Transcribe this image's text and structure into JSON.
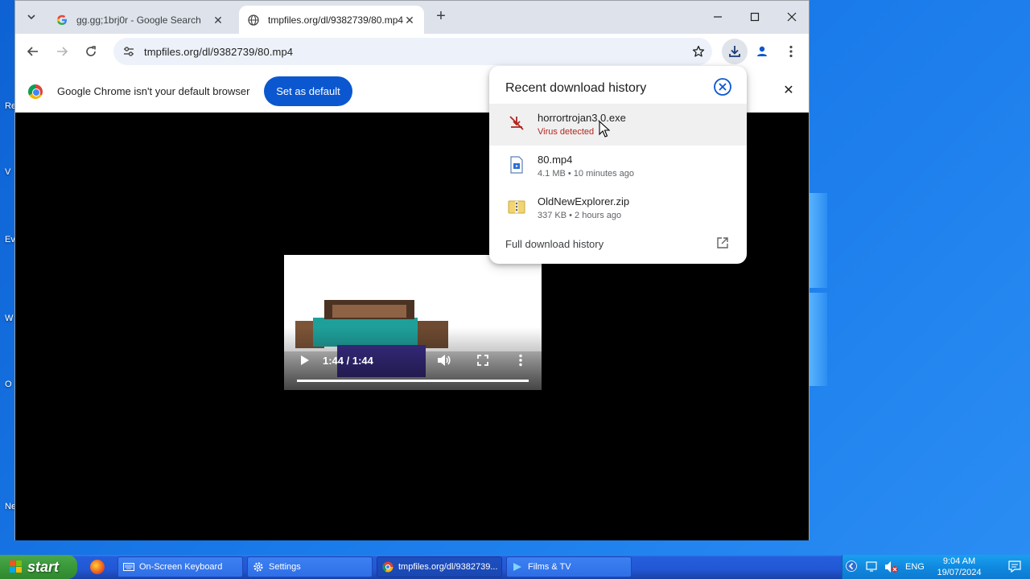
{
  "desktop": {
    "side_labels": [
      "Re",
      "V",
      "Ev",
      "W",
      "O",
      "Ne"
    ]
  },
  "browser": {
    "tabs": [
      {
        "title": "gg.gg;1brj0r - Google Search",
        "favicon": "google-g-icon",
        "active": false
      },
      {
        "title": "tmpfiles.org/dl/9382739/80.mp4",
        "favicon": "globe-icon",
        "active": true
      }
    ],
    "url": "tmpfiles.org/dl/9382739/80.mp4",
    "infobar": {
      "message": "Google Chrome isn't your default browser",
      "button_label": "Set as default"
    }
  },
  "video_player": {
    "time": "1:44 / 1:44",
    "progress_fraction": 1.0
  },
  "download_bubble": {
    "title": "Recent download history",
    "items": [
      {
        "name": "horrortrojan3.0.exe",
        "meta": "Virus detected",
        "status": "danger",
        "icon": "dangerous-file-icon"
      },
      {
        "name": "80.mp4",
        "meta": "4.1 MB • 10 minutes ago",
        "status": "complete",
        "icon": "video-file-icon"
      },
      {
        "name": "OldNewExplorer.zip",
        "meta": "337 KB • 2 hours ago",
        "status": "complete",
        "icon": "zip-file-icon"
      }
    ],
    "footer_link": "Full download history"
  },
  "taskbar": {
    "start_label": "start",
    "buttons": [
      {
        "label": "On-Screen Keyboard",
        "icon": "keyboard-icon"
      },
      {
        "label": "Settings",
        "icon": "gear-icon"
      },
      {
        "label": "tmpfiles.org/dl/9382739...",
        "icon": "chrome-icon"
      },
      {
        "label": "Films & TV",
        "icon": "films-tv-icon"
      }
    ],
    "tray": {
      "language": "ENG",
      "time": "9:04 AM",
      "date": "19/07/2024"
    }
  },
  "colors": {
    "accent_blue": "#0b57d0",
    "danger_red": "#b3261e",
    "desktop_blue": "#1a7bea"
  }
}
